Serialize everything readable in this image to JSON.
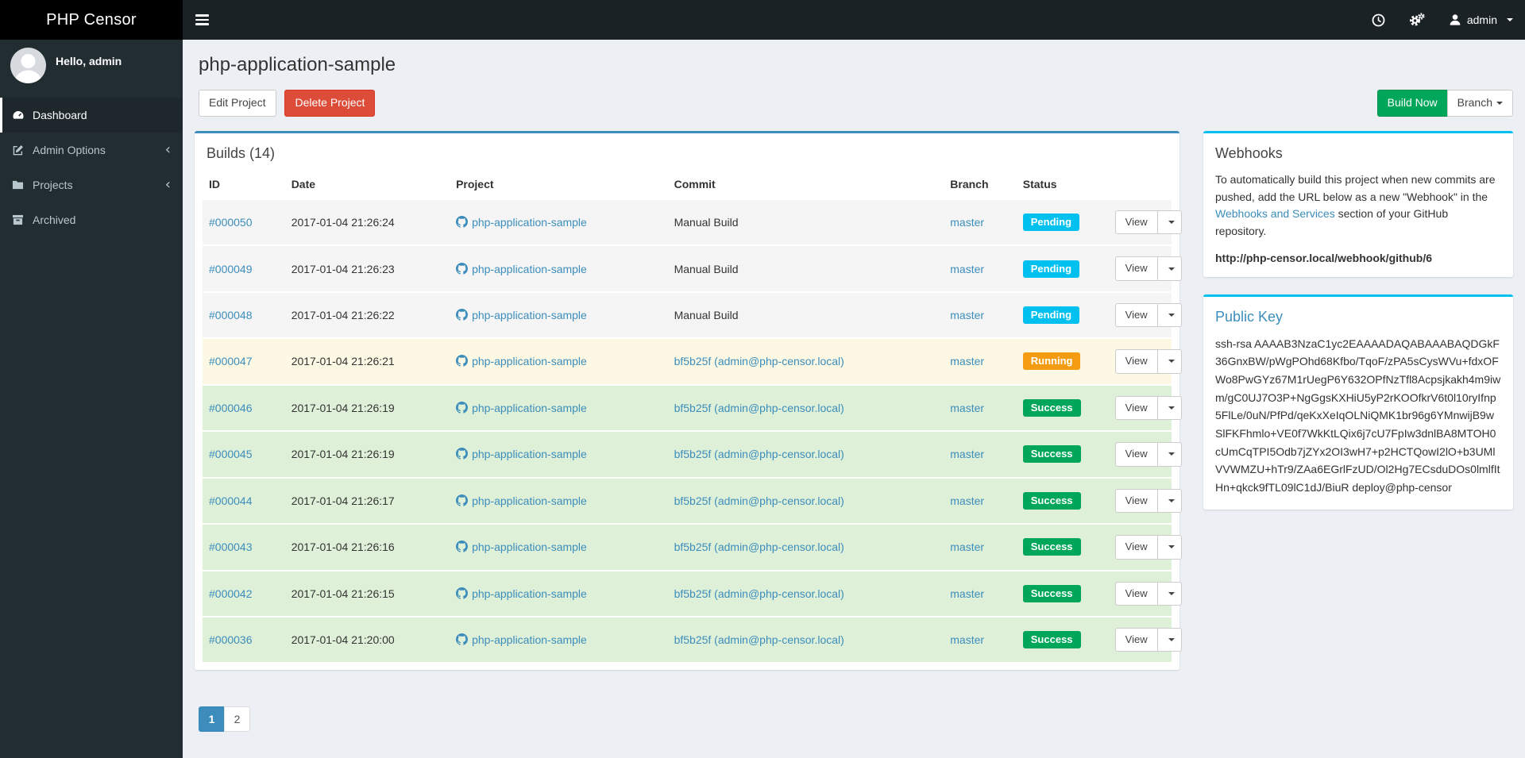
{
  "brand": {
    "title": "PHP Censor"
  },
  "navbar": {
    "user_label": "admin",
    "icons": [
      "hamburger-icon",
      "clock-icon",
      "cogs-icon",
      "user-icon",
      "caret-down-icon"
    ]
  },
  "sidebar": {
    "greeting": "Hello, admin",
    "items": [
      {
        "label": "Dashboard",
        "icon": "gauge-icon",
        "active": true
      },
      {
        "label": "Admin Options",
        "icon": "edit-icon",
        "chevron": "‹"
      },
      {
        "label": "Projects",
        "icon": "folder-icon",
        "chevron": "‹"
      },
      {
        "label": "Archived",
        "icon": "archive-icon"
      }
    ]
  },
  "page": {
    "title": "php-application-sample",
    "edit_button": "Edit Project",
    "delete_button": "Delete Project",
    "build_now_button": "Build Now",
    "branch_button": "Branch"
  },
  "builds": {
    "title": "Builds (14)",
    "columns": [
      "ID",
      "Date",
      "Project",
      "Commit",
      "Branch",
      "Status",
      ""
    ],
    "view_label": "View",
    "rows": [
      {
        "id": "#000050",
        "date": "2017-01-04 21:26:24",
        "project": "php-application-sample",
        "commit": "Manual Build",
        "commit_is_link": false,
        "branch": "master",
        "status": "Pending"
      },
      {
        "id": "#000049",
        "date": "2017-01-04 21:26:23",
        "project": "php-application-sample",
        "commit": "Manual Build",
        "commit_is_link": false,
        "branch": "master",
        "status": "Pending"
      },
      {
        "id": "#000048",
        "date": "2017-01-04 21:26:22",
        "project": "php-application-sample",
        "commit": "Manual Build",
        "commit_is_link": false,
        "branch": "master",
        "status": "Pending"
      },
      {
        "id": "#000047",
        "date": "2017-01-04 21:26:21",
        "project": "php-application-sample",
        "commit": "bf5b25f (admin@php-censor.local)",
        "commit_is_link": true,
        "branch": "master",
        "status": "Running"
      },
      {
        "id": "#000046",
        "date": "2017-01-04 21:26:19",
        "project": "php-application-sample",
        "commit": "bf5b25f (admin@php-censor.local)",
        "commit_is_link": true,
        "branch": "master",
        "status": "Success"
      },
      {
        "id": "#000045",
        "date": "2017-01-04 21:26:19",
        "project": "php-application-sample",
        "commit": "bf5b25f (admin@php-censor.local)",
        "commit_is_link": true,
        "branch": "master",
        "status": "Success"
      },
      {
        "id": "#000044",
        "date": "2017-01-04 21:26:17",
        "project": "php-application-sample",
        "commit": "bf5b25f (admin@php-censor.local)",
        "commit_is_link": true,
        "branch": "master",
        "status": "Success"
      },
      {
        "id": "#000043",
        "date": "2017-01-04 21:26:16",
        "project": "php-application-sample",
        "commit": "bf5b25f (admin@php-censor.local)",
        "commit_is_link": true,
        "branch": "master",
        "status": "Success"
      },
      {
        "id": "#000042",
        "date": "2017-01-04 21:26:15",
        "project": "php-application-sample",
        "commit": "bf5b25f (admin@php-censor.local)",
        "commit_is_link": true,
        "branch": "master",
        "status": "Success"
      },
      {
        "id": "#000036",
        "date": "2017-01-04 21:20:00",
        "project": "php-application-sample",
        "commit": "bf5b25f (admin@php-censor.local)",
        "commit_is_link": true,
        "branch": "master",
        "status": "Success"
      }
    ]
  },
  "pagination": {
    "pages": [
      {
        "label": "1",
        "active": true
      },
      {
        "label": "2",
        "active": false
      }
    ]
  },
  "webhooks": {
    "title": "Webhooks",
    "intro_before": "To automatically build this project when new commits are pushed, add the URL below as a new \"Webhook\" in the ",
    "link_text": "Webhooks and Services",
    "intro_after": " section of your GitHub repository.",
    "url": "http://php-censor.local/webhook/github/6"
  },
  "public_key": {
    "title": "Public Key",
    "key": "ssh-rsa AAAAB3NzaC1yc2EAAAADAQABAAABAQDGkF36GnxBW/pWgPOhd68Kfbo/TqoF/zPA5sCysWVu+fdxOFWo8PwGYz67M1rUegP6Y632OPfNzTfl8Acpsjkakh4m9iwm/gC0UJ7O3P+NgGgsKXHiU5yP2rKOOfkrV6t0l10ryIfnp5FlLe/0uN/PfPd/qeKxXeIqOLNiQMK1br96g6YMnwijB9wSlFKFhmlo+VE0f7WkKtLQix6j7cU7FpIw3dnlBA8MTOH0cUmCqTPI5Odb7jZYx2OI3wH7+p2HCTQowI2lO+b3UMlVVWMZU+hTr9/ZAa6EGrlFzUD/Ol2Hg7ECsduDOs0lmlfItHn+qkck9fTL09lC1dJ/BiuR deploy@php-censor"
  },
  "colors": {
    "accent_blue": "#3c8dbc",
    "info_cyan": "#00c0ef",
    "success_green": "#00a65a",
    "warning_orange": "#f39c12",
    "danger_red": "#dd4b39",
    "logo_black": "#000000",
    "navbar_dark": "#1a2226",
    "sidebar_dark": "#222d32",
    "row_pending": "#f5f5f5",
    "row_running": "#fcf8e3",
    "row_success": "#dff0d8",
    "page_background": "#ecf0f5"
  }
}
